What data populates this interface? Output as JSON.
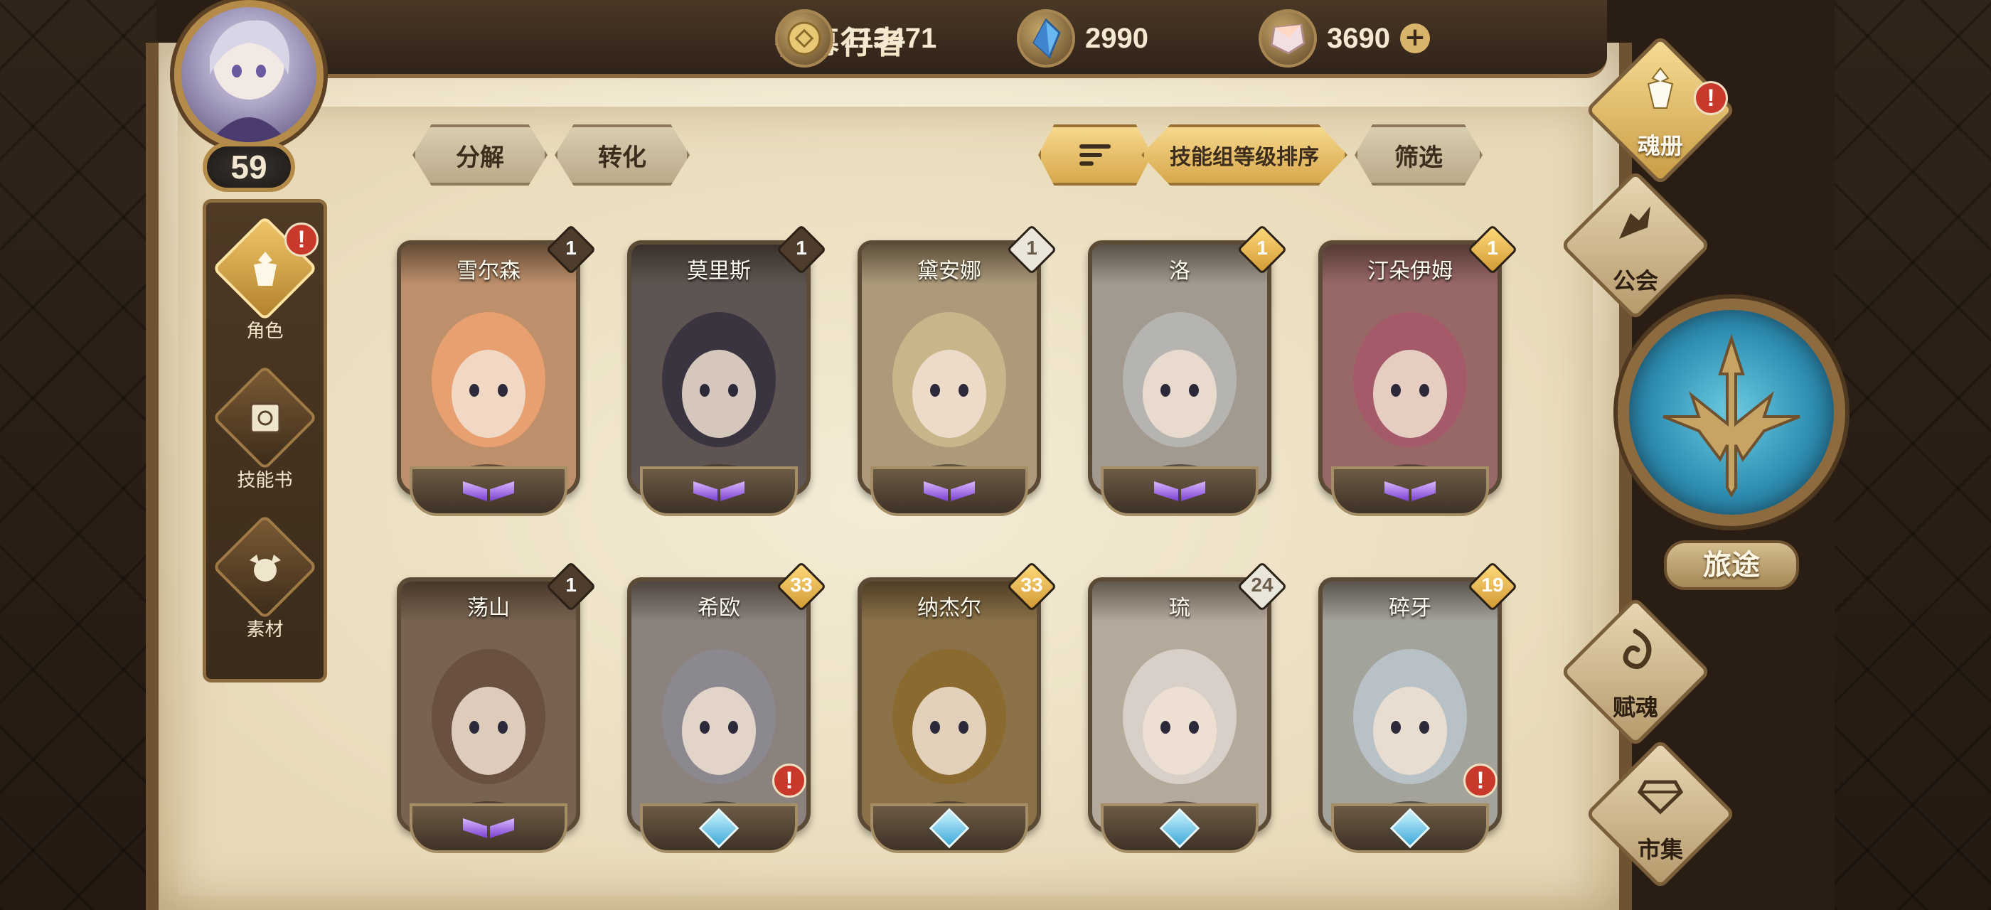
{
  "player": {
    "name": "夜幕行者",
    "level": "59"
  },
  "currencies": [
    {
      "icon": "gold-coin-icon",
      "value": "113471"
    },
    {
      "icon": "blue-crystal-icon",
      "value": "2990"
    },
    {
      "icon": "pink-gem-icon",
      "value": "3690",
      "has_plus": true
    }
  ],
  "left_nav": [
    {
      "label": "角色",
      "icon": "character-icon",
      "active": true,
      "alert": "!"
    },
    {
      "label": "技能书",
      "icon": "skill-book-icon",
      "active": false
    },
    {
      "label": "素材",
      "icon": "materials-icon",
      "active": false
    }
  ],
  "toolbar": {
    "decompose": "分解",
    "convert": "转化",
    "sort_order": "技能组等级排序",
    "filter": "筛选"
  },
  "cards": [
    {
      "name": "雪尔森",
      "level": "1",
      "level_style": "dark",
      "rank": "purple",
      "art_color": "#e8a070",
      "alert": false
    },
    {
      "name": "莫里斯",
      "level": "1",
      "level_style": "dark",
      "rank": "purple",
      "art_color": "#3a3440",
      "alert": false
    },
    {
      "name": "黛安娜",
      "level": "1",
      "level_style": "light",
      "rank": "purple",
      "art_color": "#c9b58a",
      "alert": false
    },
    {
      "name": "洛",
      "level": "1",
      "level_style": "gold",
      "rank": "purple",
      "art_color": "#b6b4b0",
      "alert": false
    },
    {
      "name": "汀朵伊姆",
      "level": "1",
      "level_style": "gold",
      "rank": "purple",
      "art_color": "#a45a68",
      "alert": false
    },
    {
      "name": "荡山",
      "level": "1",
      "level_style": "dark",
      "rank": "purple",
      "art_color": "#6a5040",
      "alert": false
    },
    {
      "name": "希欧",
      "level": "33",
      "level_style": "gold",
      "rank": "blue",
      "art_color": "#8c8890",
      "alert": true
    },
    {
      "name": "纳杰尔",
      "level": "33",
      "level_style": "gold",
      "rank": "blue",
      "art_color": "#8a6a2e",
      "alert": false
    },
    {
      "name": "琉",
      "level": "24",
      "level_style": "light",
      "rank": "blue",
      "art_color": "#d8d0c8",
      "alert": false
    },
    {
      "name": "碎牙",
      "level": "19",
      "level_style": "gold",
      "rank": "blue",
      "art_color": "#b8c2c6",
      "alert": true
    }
  ],
  "alert_symbol": "!",
  "right_nav": [
    {
      "label": "魂册",
      "icon": "soul-book-icon",
      "active": true,
      "alert": "!"
    },
    {
      "label": "公会",
      "icon": "guild-icon",
      "active": false
    },
    {
      "label": "赋魂",
      "icon": "soul-infuse-icon",
      "active": false
    },
    {
      "label": "市集",
      "icon": "market-icon",
      "active": false
    }
  ],
  "journey": {
    "label": "旅途",
    "icon": "journey-compass-icon"
  },
  "colors": {
    "gold_accent": "#d8a84c",
    "alert_red": "#c9392b",
    "parchment": "#efe4c9",
    "frame_brown": "#5b4a36"
  }
}
